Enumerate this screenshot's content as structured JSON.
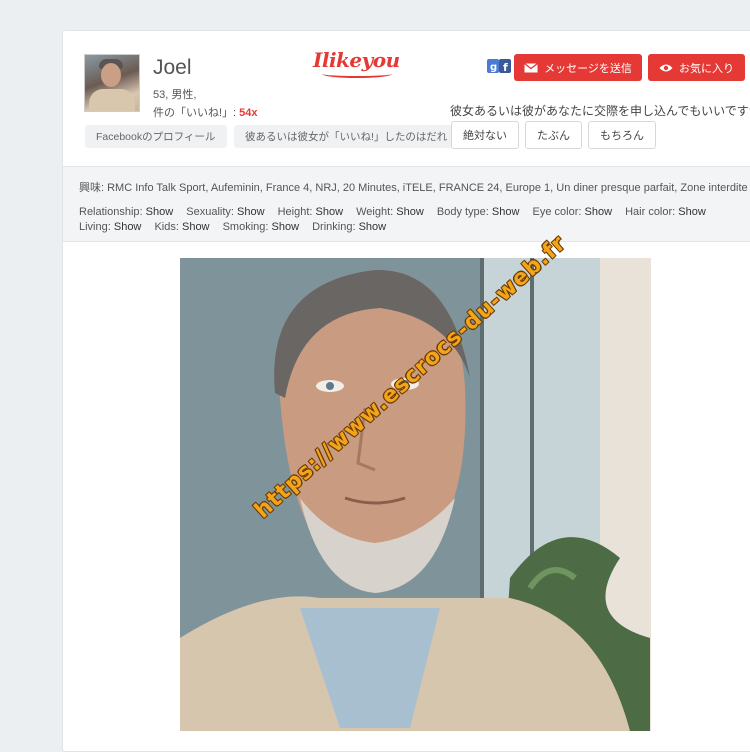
{
  "profile": {
    "name": "Joel",
    "meta": "53, 男性,",
    "likes_prefix": "件の「いいね!」: ",
    "likes_count": "54x"
  },
  "brand": {
    "logo_text": "Ilikeyou"
  },
  "actions": {
    "message_label": "メッセージを送信",
    "favorite_label": "お気に入り",
    "facebook_button": "Facebookのプロフィール",
    "liked_button": "彼あるいは彼女が「いいね!」したのはだれ"
  },
  "question": {
    "text": "彼女あるいは彼があなたに交際を申し込んでもいいですか?",
    "answers": [
      "絶対ない",
      "たぶん",
      "もちろん"
    ]
  },
  "interests": {
    "text": "興味: RMC Info Talk Sport, Aufeminin, France 4, NRJ, 20 Minutes, iTELE, FRANCE 24, Europe 1, Un diner presque parfait, Zone interdite"
  },
  "traits": [
    {
      "label": "Relationship:",
      "value": "Show"
    },
    {
      "label": "Sexuality:",
      "value": "Show"
    },
    {
      "label": "Height:",
      "value": "Show"
    },
    {
      "label": "Weight:",
      "value": "Show"
    },
    {
      "label": "Body type:",
      "value": "Show"
    },
    {
      "label": "Eye color:",
      "value": "Show"
    },
    {
      "label": "Hair color:",
      "value": "Show"
    },
    {
      "label": "Living:",
      "value": "Show"
    },
    {
      "label": "Kids:",
      "value": "Show"
    },
    {
      "label": "Smoking:",
      "value": "Show"
    },
    {
      "label": "Drinking:",
      "value": "Show"
    }
  ],
  "photo": {
    "watermark": "https://www.escrocs-du-web.fr"
  },
  "colors": {
    "accent": "#e53935",
    "watermark": "#f2a51a"
  },
  "icons": {
    "message": "envelope-icon",
    "favorite": "eye-icon",
    "social": "google-facebook-icon"
  }
}
